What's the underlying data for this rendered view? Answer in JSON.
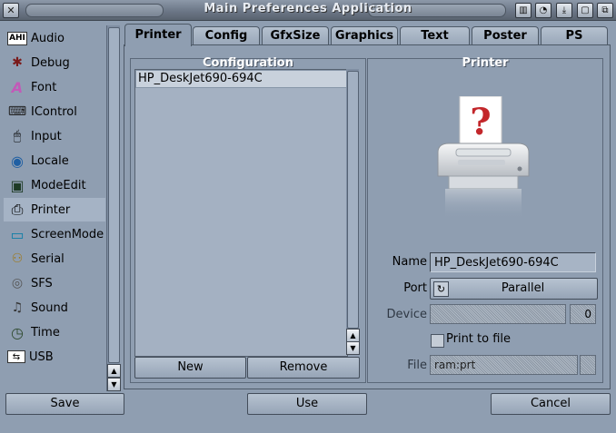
{
  "window": {
    "title": "Main Preferences Application"
  },
  "sidebar": {
    "items": [
      {
        "label": "Audio",
        "icon": "ahi-audio-icon",
        "glyph": "AHI"
      },
      {
        "label": "Debug",
        "icon": "bug-icon",
        "glyph": "✱"
      },
      {
        "label": "Font",
        "icon": "font-icon",
        "glyph": "A"
      },
      {
        "label": "IControl",
        "icon": "keyboard-icon",
        "glyph": "⌨"
      },
      {
        "label": "Input",
        "icon": "mouse-icon",
        "glyph": "🖱"
      },
      {
        "label": "Locale",
        "icon": "globe-icon",
        "glyph": "◉"
      },
      {
        "label": "ModeEdit",
        "icon": "monitor-icon",
        "glyph": "▣"
      },
      {
        "label": "Printer",
        "icon": "printer-icon",
        "glyph": "⎙"
      },
      {
        "label": "ScreenMode",
        "icon": "screen-icon",
        "glyph": "▭"
      },
      {
        "label": "Serial",
        "icon": "serial-port-icon",
        "glyph": "⚇"
      },
      {
        "label": "SFS",
        "icon": "disk-icon",
        "glyph": "◎"
      },
      {
        "label": "Sound",
        "icon": "speaker-icon",
        "glyph": "♫"
      },
      {
        "label": "Time",
        "icon": "clock-icon",
        "glyph": "◷"
      },
      {
        "label": "USB",
        "icon": "usb-icon",
        "glyph": "⇆"
      }
    ],
    "selected": "Printer"
  },
  "tabs": [
    {
      "label": "Printer",
      "active": true
    },
    {
      "label": "Config",
      "active": false
    },
    {
      "label": "GfxSize",
      "active": false
    },
    {
      "label": "Graphics",
      "active": false
    },
    {
      "label": "Text",
      "active": false
    },
    {
      "label": "Poster",
      "active": false
    },
    {
      "label": "PS",
      "active": false
    }
  ],
  "configuration": {
    "title": "Configuration",
    "items": [
      "HP_DeskJet690-694C"
    ],
    "new_label": "New",
    "remove_label": "Remove"
  },
  "printer": {
    "title": "Printer",
    "name_label": "Name",
    "name_value": "HP_DeskJet690-694C",
    "port_label": "Port",
    "port_value": "Parallel",
    "device_label": "Device",
    "device_value": "0",
    "print_to_file_label": "Print to file",
    "print_to_file_checked": false,
    "file_label": "File",
    "file_value": "ram:prt"
  },
  "footer": {
    "save_label": "Save",
    "use_label": "Use",
    "cancel_label": "Cancel"
  },
  "colors": {
    "background": "#8f9eb1",
    "selected_row": "#a5b3c5",
    "group_title": "#ffffff"
  }
}
